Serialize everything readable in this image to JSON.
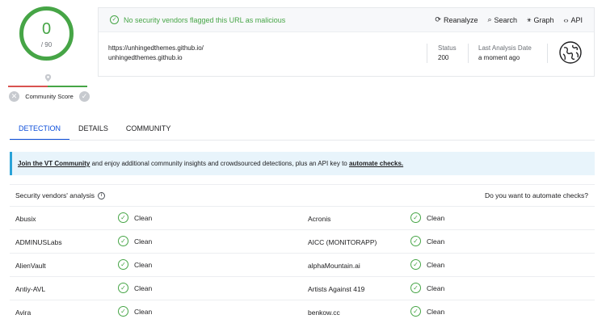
{
  "score": {
    "detections": "0",
    "total": "/ 90"
  },
  "community": {
    "label": "Community Score",
    "left_icon": "close-icon",
    "right_icon": "check-icon"
  },
  "banner": {
    "message": "No security vendors flagged this URL as malicious"
  },
  "actions": [
    {
      "icon": "reanalyze-icon",
      "glyph": "⟳",
      "label": "Reanalyze"
    },
    {
      "icon": "search-icon",
      "glyph": "⌕",
      "label": "Search"
    },
    {
      "icon": "graph-icon",
      "glyph": "⚹",
      "label": "Graph"
    },
    {
      "icon": "api-icon",
      "glyph": "‹›",
      "label": "API"
    }
  ],
  "url": {
    "full": "https://unhingedthemes.github.io/",
    "host": "unhingedthemes.github.io"
  },
  "status": {
    "label": "Status",
    "value": "200"
  },
  "last_analysis": {
    "label": "Last Analysis Date",
    "value": "a moment ago"
  },
  "tabs": [
    "DETECTION",
    "DETAILS",
    "COMMUNITY"
  ],
  "info_banner": {
    "link1": "Join the VT Community",
    "middle": " and enjoy additional community insights and crowdsourced detections, plus an API key to ",
    "link2": "automate checks."
  },
  "vendors_section": {
    "title": "Security vendors' analysis",
    "automate_prompt": "Do you want to automate checks?"
  },
  "vendors": [
    {
      "left": "Abusix",
      "left_result": "Clean",
      "right": "Acronis",
      "right_result": "Clean"
    },
    {
      "left": "ADMINUSLabs",
      "left_result": "Clean",
      "right": "AICC (MONITORAPP)",
      "right_result": "Clean"
    },
    {
      "left": "AlienVault",
      "left_result": "Clean",
      "right": "alphaMountain.ai",
      "right_result": "Clean"
    },
    {
      "left": "Antiy-AVL",
      "left_result": "Clean",
      "right": "Artists Against 419",
      "right_result": "Clean"
    },
    {
      "left": "Avira",
      "left_result": "Clean",
      "right": "benkow.cc",
      "right_result": "Clean"
    }
  ],
  "colors": {
    "clean": "#46a546",
    "accent": "#0b4dda",
    "info_border": "#2aa3d8"
  }
}
